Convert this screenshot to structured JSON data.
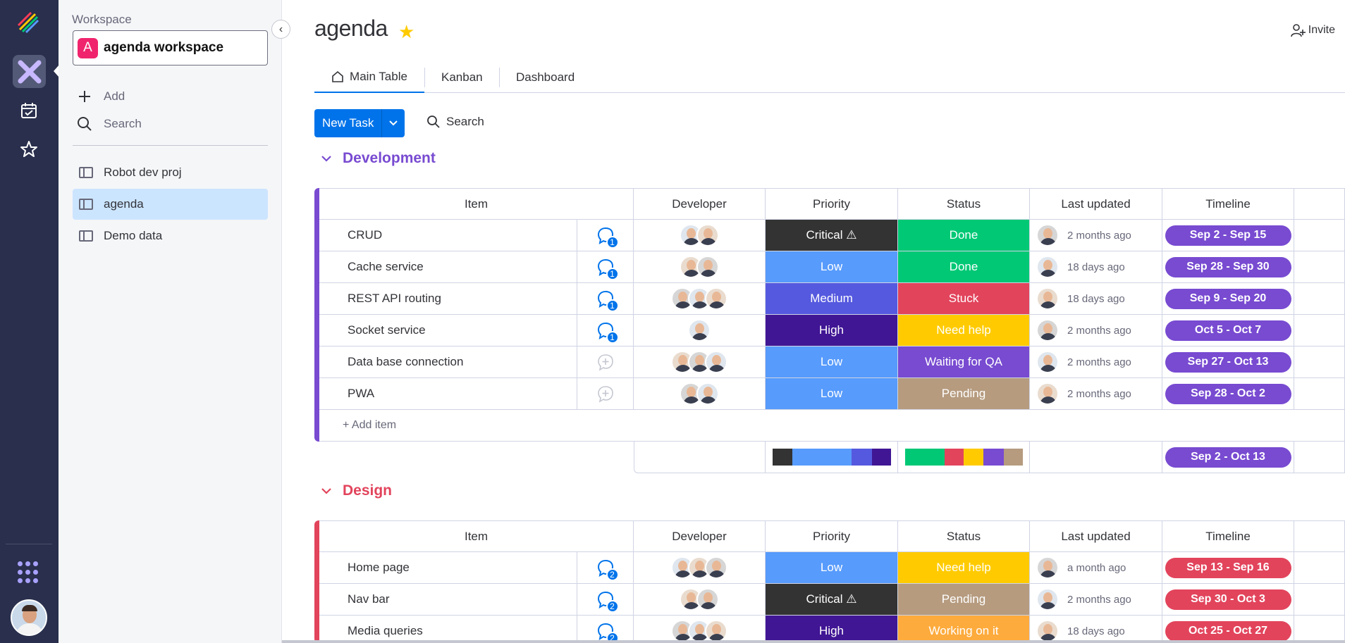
{
  "workspace": {
    "label": "Workspace",
    "badge": "A",
    "name": "agenda workspace",
    "add_label": "Add",
    "search_label": "Search",
    "boards": [
      {
        "label": "Robot dev proj",
        "selected": false
      },
      {
        "label": "agenda",
        "selected": true
      },
      {
        "label": "Demo data",
        "selected": false
      }
    ]
  },
  "header": {
    "title": "agenda",
    "invite_label": "Invite",
    "tabs": [
      "Main Table",
      "Kanban",
      "Dashboard"
    ],
    "active_tab": "Main Table"
  },
  "toolbar": {
    "new_task_label": "New Task",
    "search_label": "Search"
  },
  "columns": [
    "Item",
    "Developer",
    "Priority",
    "Status",
    "Last updated",
    "Timeline"
  ],
  "colors": {
    "Critical ⚠": "#333333",
    "Low": "#579bfc",
    "Medium": "#5559df",
    "High": "#401694",
    "Done": "#00c875",
    "Stuck": "#e2445c",
    "Need help": "#ffcb00",
    "Waiting for QA": "#784bd1",
    "Pending": "#b69b7f",
    "Working on it": "#fdab3d"
  },
  "groups": [
    {
      "name": "Development",
      "color": "#784bd1",
      "add_item_label": "+ Add item",
      "summary_timeline": "Sep 2 - Oct 13",
      "priority_summary": [
        {
          "color": "#333333",
          "fraction": 0.17
        },
        {
          "color": "#579bfc",
          "fraction": 0.5
        },
        {
          "color": "#5559df",
          "fraction": 0.17
        },
        {
          "color": "#401694",
          "fraction": 0.16
        }
      ],
      "status_summary": [
        {
          "color": "#00c875",
          "fraction": 0.34
        },
        {
          "color": "#e2445c",
          "fraction": 0.16
        },
        {
          "color": "#ffcb00",
          "fraction": 0.17
        },
        {
          "color": "#784bd1",
          "fraction": 0.17
        },
        {
          "color": "#b69b7f",
          "fraction": 0.16
        }
      ],
      "rows": [
        {
          "item": "CRUD",
          "updates": "1",
          "devs": 2,
          "priority": "Critical ⚠",
          "status": "Done",
          "updated": "2 months ago",
          "timeline": "Sep 2 - Sep 15"
        },
        {
          "item": "Cache service",
          "updates": "1",
          "devs": 2,
          "priority": "Low",
          "status": "Done",
          "updated": "18 days ago",
          "timeline": "Sep 28 - Sep 30"
        },
        {
          "item": "REST API routing",
          "updates": "1",
          "devs": 3,
          "priority": "Medium",
          "status": "Stuck",
          "updated": "18 days ago",
          "timeline": "Sep 9 - Sep 20"
        },
        {
          "item": "Socket service",
          "updates": "1",
          "devs": 1,
          "priority": "High",
          "status": "Need help",
          "updated": "2 months ago",
          "timeline": "Oct 5 - Oct 7"
        },
        {
          "item": "Data base connection",
          "updates": "",
          "devs": 3,
          "priority": "Low",
          "status": "Waiting for QA",
          "updated": "2 months ago",
          "timeline": "Sep 27 - Oct 13"
        },
        {
          "item": "PWA",
          "updates": "",
          "devs": 2,
          "priority": "Low",
          "status": "Pending",
          "updated": "2 months ago",
          "timeline": "Sep 28 - Oct 2"
        }
      ]
    },
    {
      "name": "Design",
      "color": "#e2445c",
      "rows": [
        {
          "item": "Home page",
          "updates": "2",
          "devs": 3,
          "priority": "Low",
          "status": "Need help",
          "updated": "a month ago",
          "timeline": "Sep 13 - Sep 16"
        },
        {
          "item": "Nav bar",
          "updates": "2",
          "devs": 2,
          "priority": "Critical ⚠",
          "status": "Pending",
          "updated": "2 months ago",
          "timeline": "Sep 30 - Oct 3"
        },
        {
          "item": "Media queries",
          "updates": "2",
          "devs": 3,
          "priority": "High",
          "status": "Working on it",
          "updated": "18 days ago",
          "timeline": "Oct 25 - Oct 27"
        }
      ]
    }
  ]
}
